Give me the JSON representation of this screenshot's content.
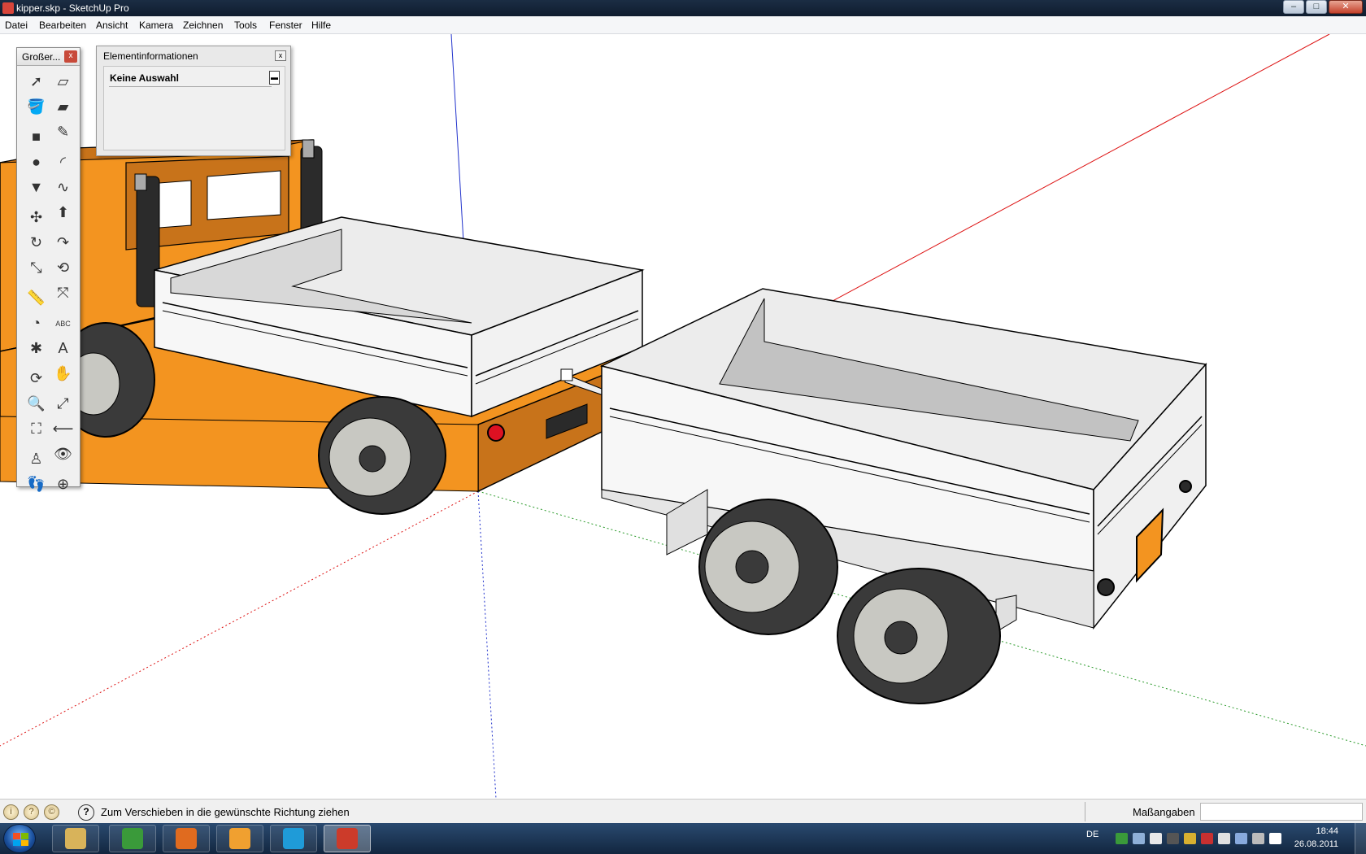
{
  "window": {
    "title": "kipper.skp - SketchUp Pro",
    "buttons": {
      "minimize": "–",
      "maximize": "□",
      "close": "✕"
    }
  },
  "menu": [
    "Datei",
    "Bearbeiten",
    "Ansicht",
    "Kamera",
    "Zeichnen",
    "Tools",
    "Fenster",
    "Hilfe"
  ],
  "tool_palette": {
    "title": "Großer...",
    "close": "x",
    "tools": [
      {
        "name": "select-tool",
        "glyph": "➚"
      },
      {
        "name": "make-component-tool",
        "glyph": "▱"
      },
      {
        "name": "paint-bucket-tool",
        "glyph": "🪣"
      },
      {
        "name": "eraser-tool",
        "glyph": "▰"
      },
      {
        "name": "rectangle-tool",
        "glyph": "■"
      },
      {
        "name": "line-tool",
        "glyph": "✎"
      },
      {
        "name": "circle-tool",
        "glyph": "●"
      },
      {
        "name": "arc-tool",
        "glyph": "◜"
      },
      {
        "name": "polygon-tool",
        "glyph": "▼"
      },
      {
        "name": "freehand-tool",
        "glyph": "∿"
      },
      {
        "name": "move-tool",
        "glyph": "✣"
      },
      {
        "name": "push-pull-tool",
        "glyph": "⬆"
      },
      {
        "name": "rotate-tool",
        "glyph": "↻"
      },
      {
        "name": "follow-me-tool",
        "glyph": "↷"
      },
      {
        "name": "scale-tool",
        "glyph": "⤡"
      },
      {
        "name": "offset-tool",
        "glyph": "⟲"
      },
      {
        "name": "tape-measure-tool",
        "glyph": "📏"
      },
      {
        "name": "dimension-tool",
        "glyph": "⤧"
      },
      {
        "name": "protractor-tool",
        "glyph": "◔"
      },
      {
        "name": "text-tool",
        "glyph": "ABC"
      },
      {
        "name": "axes-tool",
        "glyph": "✱"
      },
      {
        "name": "3d-text-tool",
        "glyph": "A"
      },
      {
        "name": "orbit-tool",
        "glyph": "⟳"
      },
      {
        "name": "pan-tool",
        "glyph": "✋"
      },
      {
        "name": "zoom-tool",
        "glyph": "🔍"
      },
      {
        "name": "zoom-window-tool",
        "glyph": "⤢"
      },
      {
        "name": "zoom-extents-tool",
        "glyph": "⛶"
      },
      {
        "name": "previous-view-tool",
        "glyph": "⟵"
      },
      {
        "name": "position-camera-tool",
        "glyph": "♙"
      },
      {
        "name": "look-around-tool",
        "glyph": "👁"
      },
      {
        "name": "walk-tool",
        "glyph": "👣"
      },
      {
        "name": "section-plane-tool",
        "glyph": "⊕"
      }
    ]
  },
  "entity_info": {
    "title": "Elementinformationen",
    "close": "x",
    "selection": "Keine Auswahl",
    "toggle": "▬"
  },
  "status": {
    "icons": [
      "i",
      "?",
      "©"
    ],
    "help": "?",
    "message": "Zum Verschieben in die gewünschte Richtung ziehen",
    "vcb_label": "Maßangaben",
    "vcb_value": ""
  },
  "taskbar": {
    "apps": [
      {
        "name": "explorer",
        "color": "#d8b35a"
      },
      {
        "name": "chrome",
        "color": "#3a9a3a"
      },
      {
        "name": "firefox",
        "color": "#e06b1f"
      },
      {
        "name": "media-player",
        "color": "#f0a030"
      },
      {
        "name": "skype",
        "color": "#1f9bd8"
      },
      {
        "name": "sketchup",
        "color": "#cc3b2a"
      }
    ],
    "language": "DE",
    "time": "18:44",
    "date": "26.08.2011"
  },
  "colors": {
    "truck_orange": "#f39420",
    "truck_orange_dark": "#c8731a",
    "axis_red": "#d11",
    "axis_green": "#2a9a2a",
    "axis_blue": "#2233cc"
  }
}
